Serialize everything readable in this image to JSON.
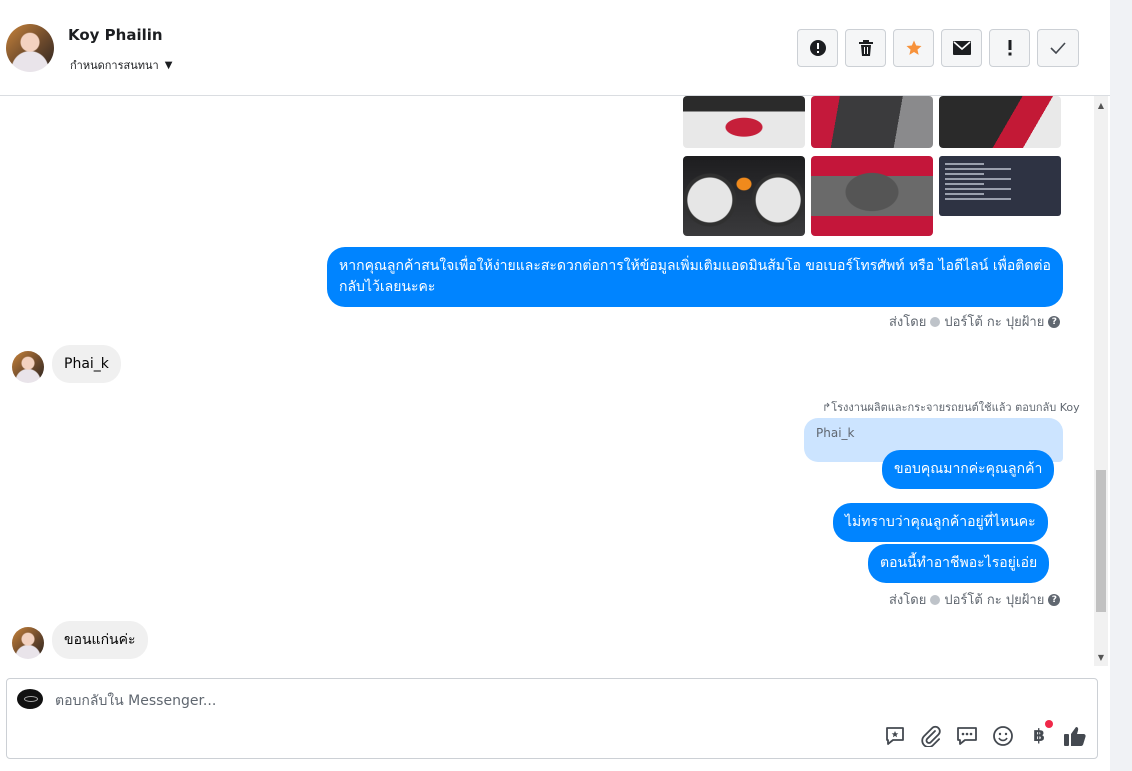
{
  "header": {
    "name": "Koy Phailin",
    "subtitle": "กำหนดการสนทนา",
    "actions": [
      "report-icon",
      "trash-icon",
      "star-icon",
      "envelope-icon",
      "exclamation-icon",
      "check-icon"
    ],
    "star_color": "#f7923b"
  },
  "messages": {
    "out1": "หากคุณลูกค้าสนใจเพื่อให้ง่ายและสะดวกต่อการให้ข้อมูลเพิ่มเติมแอดมินส้มโอ ขอเบอร์โทรศัพท์ หรือ ไอดีไลน์ เพื่อติดต่อกลับไว้เลยนะคะ",
    "sent_by_prefix": "ส่งโดย",
    "sent_by_name": "ปอร์โต้ กะ ปุยฝ้าย",
    "in1": "Phai_k",
    "reply_note": "↱โรงงานผลิตและกระจายรถยนต์ใช้แล้ว ตอบกลับ Koy",
    "quoted": "Phai_k",
    "out2": "ขอบคุณมากค่ะคุณลูกค้า",
    "out3": "ไม่ทราบว่าคุณลูกค้าอยู่ที่ไหนคะ",
    "out4": "ตอนนี้ทำอาชีพอะไรอยู่เอ่ย",
    "in2": "ขอนแก่นค่ะ"
  },
  "composer": {
    "placeholder": "ตอบกลับใน Messenger...",
    "tools": [
      "saved-reply-icon",
      "attachment-icon",
      "chat-bubbles-icon",
      "emoji-icon",
      "baht-payment-icon",
      "thumbs-up-icon"
    ],
    "baht_symbol": "฿"
  },
  "colors": {
    "outgoing": "#0084ff",
    "incoming": "#f0f0f0",
    "quoted": "#cce4ff"
  }
}
